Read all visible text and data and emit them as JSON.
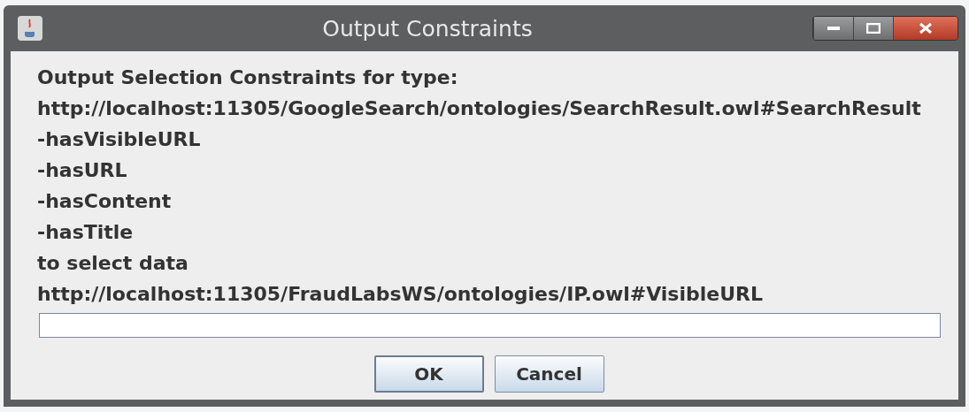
{
  "window": {
    "title": "Output Constraints"
  },
  "lines": [
    "Output Selection Constraints for type:",
    "http://localhost:11305/GoogleSearch/ontologies/SearchResult.owl#SearchResult",
    "-hasVisibleURL",
    "-hasURL",
    "-hasContent",
    "-hasTitle",
    "to select data",
    "http://localhost:11305/FraudLabsWS/ontologies/IP.owl#VisibleURL"
  ],
  "buttons": [
    {
      "label": "OK",
      "default": true
    },
    {
      "label": "Cancel",
      "default": false
    }
  ]
}
